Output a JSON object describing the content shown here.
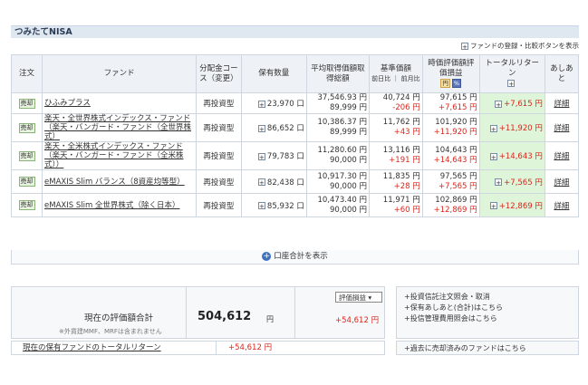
{
  "section": {
    "title": "つみたてNISA"
  },
  "toggle": {
    "label": "ファンドの登録・比較ボタンを表示"
  },
  "table": {
    "headers": {
      "order": "注文",
      "fund": "ファンド",
      "course": "分配金コース（変更）",
      "holdings": "保有数量",
      "avg": "平均取得価額取得総額",
      "nav": "基準価額",
      "nav_sub": "前日比 ｜ 前月比",
      "value": "時価評価額評価損益",
      "value_tag1": "円",
      "value_tag2": "%",
      "return": "トータルリターン",
      "ashi": "あしあと"
    },
    "rows": [
      {
        "order": "売却",
        "fund": "ひふみプラス",
        "course": "再投資型",
        "qty": "23,970 口",
        "avg_price": "37,546.93 円",
        "avg_total": "89,999 円",
        "nav": "40,724 円",
        "nav_change": "-206 円",
        "value": "97,615 円",
        "value_pl": "+7,615 円",
        "total_return": "+7,615 円",
        "detail": "詳細"
      },
      {
        "order": "売却",
        "fund": "楽天・全世界株式インデックス・ファンド（楽天・バンガード・ファンド（全世界株式）",
        "course": "再投資型",
        "qty": "86,652 口",
        "avg_price": "10,386.37 円",
        "avg_total": "89,999 円",
        "nav": "11,762 円",
        "nav_change": "+43 円",
        "value": "101,920 円",
        "value_pl": "+11,920 円",
        "total_return": "+11,920 円",
        "detail": "詳細"
      },
      {
        "order": "売却",
        "fund": "楽天・全米株式インデックス・ファンド（楽天・バンガード・ファンド（全米株式））",
        "course": "再投資型",
        "qty": "79,783 口",
        "avg_price": "11,280.60 円",
        "avg_total": "90,000 円",
        "nav": "13,116 円",
        "nav_change": "+191 円",
        "value": "104,643 円",
        "value_pl": "+14,643 円",
        "total_return": "+14,643 円",
        "detail": "詳細"
      },
      {
        "order": "売却",
        "fund": "eMAXIS Slim バランス（8資産均等型）",
        "course": "再投資型",
        "qty": "82,438 口",
        "avg_price": "10,917.30 円",
        "avg_total": "90,000 円",
        "nav": "11,835 円",
        "nav_change": "+28 円",
        "value": "97,565 円",
        "value_pl": "+7,565 円",
        "total_return": "+7,565 円",
        "detail": "詳細"
      },
      {
        "order": "売却",
        "fund": "eMAXIS Slim 全世界株式（除く日本）",
        "course": "再投資型",
        "qty": "85,932 口",
        "avg_price": "10,473.40 円",
        "avg_total": "90,000 円",
        "nav": "11,971 円",
        "nav_change": "+60 円",
        "value": "102,869 円",
        "value_pl": "+12,869 円",
        "total_return": "+12,869 円",
        "detail": "詳細"
      }
    ]
  },
  "show_total": {
    "label": "口座合計を表示"
  },
  "summary": {
    "label": "現在の評価額合計",
    "note": "※外貨建MMF、MRFは含まれません",
    "value": "504,612",
    "unit": "円",
    "select": "評価損益",
    "gain": "+54,612 円"
  },
  "return_row": {
    "label": "現在の保有ファンドのトータルリターン",
    "value": "+54,612 円"
  },
  "links": {
    "l1": "+投資信託注文照会・取消",
    "l2": "+保有あしあと(合計)はこちら",
    "l3": "+投信管理費用照会はこちら"
  },
  "past": {
    "label": "+過去に売却済みのファンドはこちら"
  }
}
